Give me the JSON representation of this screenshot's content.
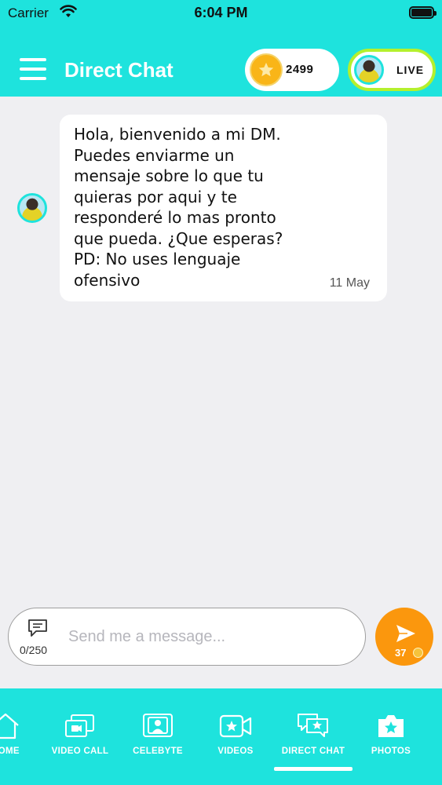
{
  "status_bar": {
    "carrier": "Carrier",
    "time": "6:04 PM"
  },
  "header": {
    "title": "Direct Chat",
    "coins": "2499",
    "live_label": "LIVE"
  },
  "chat": {
    "messages": [
      {
        "text": "Hola, bienvenido a mi DM.\nPuedes enviarme un\nmensaje sobre lo que tu\nquieras por aqui y te\nresponderé lo mas pronto\nque pueda. ¿Que esperas?\nPD: No uses lenguaje\nofensivo",
        "date": "11 May"
      }
    ]
  },
  "composer": {
    "placeholder": "Send me a message...",
    "char_counter": "0/250",
    "send_cost": "37"
  },
  "bottom_nav": {
    "items": [
      {
        "label": "HOME",
        "icon": "home-icon"
      },
      {
        "label": "VIDEO CALL",
        "icon": "video-call-icon"
      },
      {
        "label": "CELEBYTE",
        "icon": "celebyte-icon"
      },
      {
        "label": "VIDEOS",
        "icon": "videos-icon"
      },
      {
        "label": "DIRECT CHAT",
        "icon": "direct-chat-icon"
      },
      {
        "label": "PHOTOS",
        "icon": "photos-icon"
      }
    ],
    "active": "DIRECT CHAT"
  },
  "colors": {
    "brand": "#1ee3dd",
    "send": "#fb970d",
    "coin": "#f9b518",
    "live_ring": "#b4f02d",
    "background": "#efeff2"
  }
}
